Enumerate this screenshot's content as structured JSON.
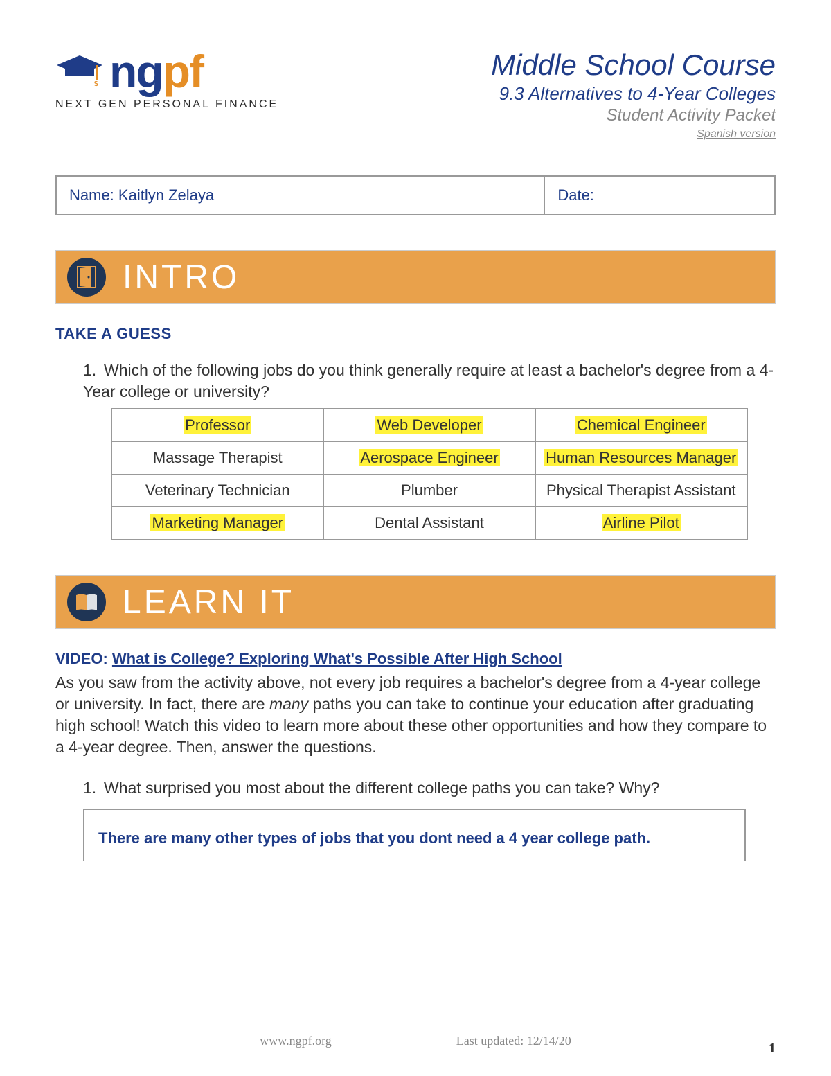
{
  "logo": {
    "subtext": "NEXT GEN PERSONAL FINANCE"
  },
  "header": {
    "course": "Middle School Course",
    "topic": "9.3 Alternatives to 4-Year Colleges",
    "packet": "Student Activity Packet",
    "spanish": "Spanish version"
  },
  "name_row": {
    "name_label": "Name: ",
    "name_value": "Kaitlyn Zelaya",
    "date_label": "Date:"
  },
  "intro": {
    "banner": "INTRO",
    "subheading": "TAKE A GUESS",
    "q1_num": "1.",
    "q1_text": "Which of the following jobs do you think generally require at least a bachelor's degree from a 4-Year college or university?",
    "jobs": [
      [
        {
          "t": "Professor",
          "hl": true
        },
        {
          "t": "Web Developer",
          "hl": true
        },
        {
          "t": "Chemical Engineer",
          "hl": true
        }
      ],
      [
        {
          "t": "Massage Therapist",
          "hl": false
        },
        {
          "t": "Aerospace Engineer",
          "hl": true
        },
        {
          "t": "Human Resources Manager",
          "hl": true
        }
      ],
      [
        {
          "t": "Veterinary Technician",
          "hl": false
        },
        {
          "t": "Plumber",
          "hl": false
        },
        {
          "t": "Physical Therapist Assistant",
          "hl": false
        }
      ],
      [
        {
          "t": "Marketing Manager",
          "hl": true
        },
        {
          "t": "Dental Assistant",
          "hl": false
        },
        {
          "t": "Airline Pilot",
          "hl": true
        }
      ]
    ]
  },
  "learn": {
    "banner": "LEARN IT",
    "video_label": "VIDEO: ",
    "video_link": "What is College? Exploring What's Possible After High School",
    "body_1": "As you saw from the activity above, not every job requires a bachelor's degree from a 4-year college or university. In fact, there are ",
    "body_em": "many",
    "body_2": " paths you can take to continue your education after graduating high school! Watch this video to learn more about these other opportunities and how they compare to a 4-year degree. Then, answer the questions.",
    "q1_num": "1.",
    "q1_text": "What surprised you most about the different college paths you can take? Why?",
    "answer": "There are many other types of jobs that you dont need a 4 year college path."
  },
  "footer": {
    "url": "www.ngpf.org",
    "updated": "Last updated: 12/14/20",
    "page": "1"
  }
}
